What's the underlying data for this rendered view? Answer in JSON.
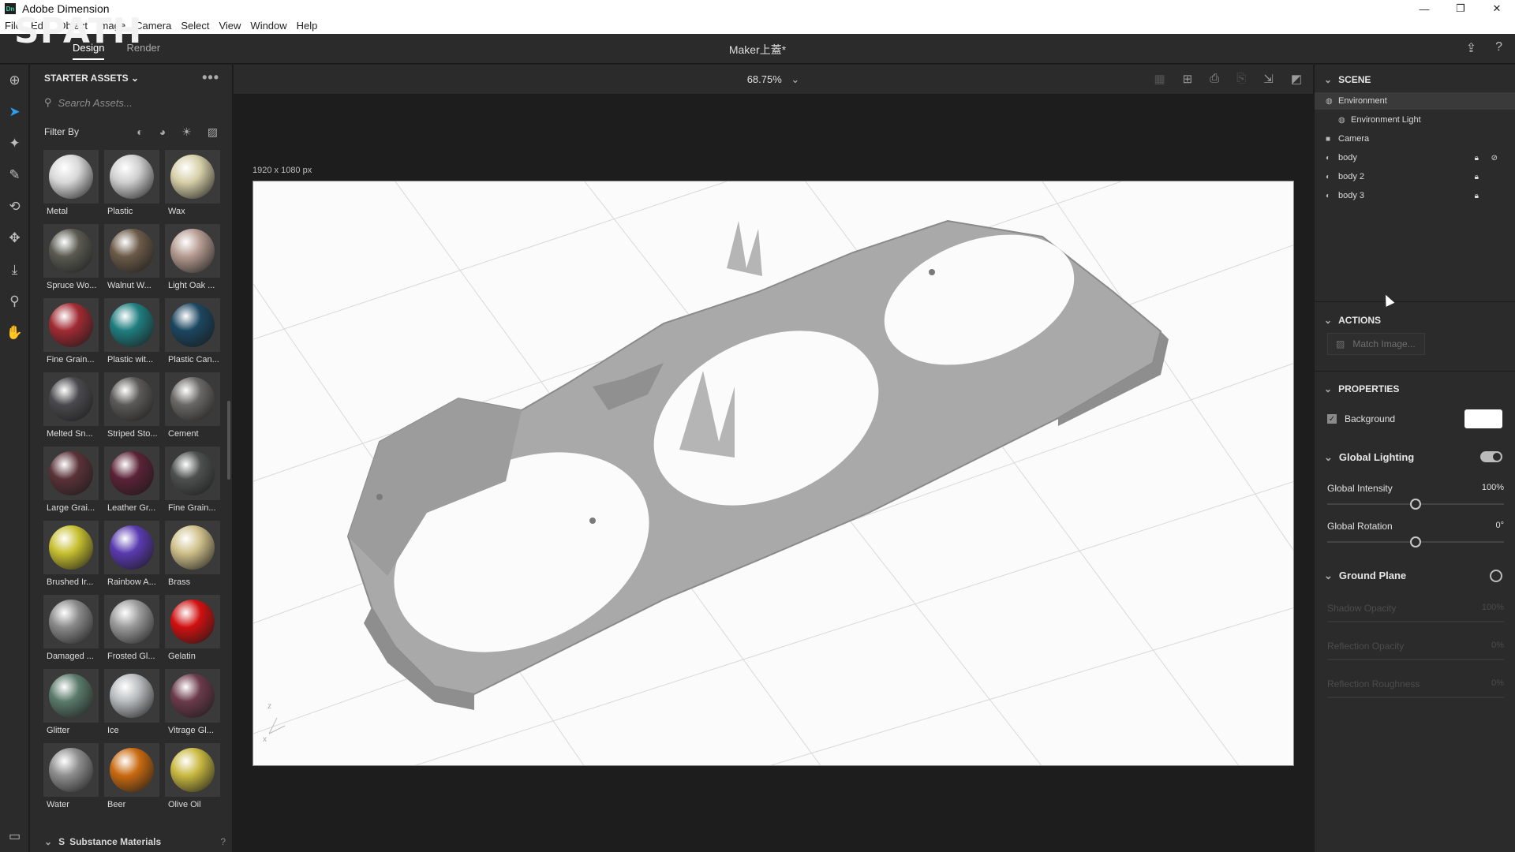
{
  "window": {
    "title": "Adobe Dimension",
    "logo_text": "Dn",
    "controls": [
      "—",
      "❐",
      "✕"
    ]
  },
  "menu": {
    "items": [
      "File",
      "Edit",
      "Object",
      "Image",
      "Camera",
      "Select",
      "View",
      "Window",
      "Help"
    ]
  },
  "topbar": {
    "brand_overlay": "SPATH",
    "tabs": [
      "Design",
      "Render"
    ],
    "document_title": "Maker上蓋*"
  },
  "assets": {
    "header": "STARTER ASSETS ⌄",
    "search_placeholder": "Search Assets...",
    "filter_label": "Filter By",
    "materials": [
      {
        "label": "Metal",
        "color": "#d8d8d8"
      },
      {
        "label": "Plastic",
        "color": "#cfcfcf"
      },
      {
        "label": "Wax",
        "color": "#d6cfa8"
      },
      {
        "label": "Spruce Wo...",
        "color": "#5a5a52"
      },
      {
        "label": "Walnut W...",
        "color": "#6b5a48"
      },
      {
        "label": "Light Oak ...",
        "color": "#b49a90"
      },
      {
        "label": "Fine Grain...",
        "color": "#a02a32"
      },
      {
        "label": "Plastic wit...",
        "color": "#1f7d7f"
      },
      {
        "label": "Plastic Can...",
        "color": "#1b4660"
      },
      {
        "label": "Melted Sn...",
        "color": "#4a4a4e"
      },
      {
        "label": "Striped Sto...",
        "color": "#5c5a58"
      },
      {
        "label": "Cement",
        "color": "#6a6866"
      },
      {
        "label": "Large Grai...",
        "color": "#5a3238"
      },
      {
        "label": "Leather Gr...",
        "color": "#5a2236"
      },
      {
        "label": "Fine Grain...",
        "color": "#4e5050"
      },
      {
        "label": "Brushed Ir...",
        "color": "#c8c030"
      },
      {
        "label": "Rainbow A...",
        "color": "#5a3ab0"
      },
      {
        "label": "Brass",
        "color": "#cfc08a"
      },
      {
        "label": "Damaged ...",
        "color": "#8a8a8a"
      },
      {
        "label": "Frosted Gl...",
        "color": "#9a9a9a"
      },
      {
        "label": "Gelatin",
        "color": "#d01010"
      },
      {
        "label": "Glitter",
        "color": "#5a7a6a"
      },
      {
        "label": "Ice",
        "color": "#b8bcbe"
      },
      {
        "label": "Vitrage Gl...",
        "color": "#6a3a4a"
      },
      {
        "label": "Water",
        "color": "#8e8e8e"
      },
      {
        "label": "Beer",
        "color": "#c86a10"
      },
      {
        "label": "Olive Oil",
        "color": "#c8b840"
      }
    ],
    "substance_label": "Substance Materials",
    "help": "?"
  },
  "canvas": {
    "zoom": "68.75%",
    "size_label": "1920 x 1080 px",
    "axis_labels": [
      "z",
      "x"
    ]
  },
  "scene": {
    "title": "SCENE",
    "items": [
      {
        "label": "Environment",
        "icon": "globe-icon",
        "highlight": true
      },
      {
        "label": "Environment Light",
        "icon": "globe-icon",
        "indent": true
      },
      {
        "label": "Camera",
        "icon": "camera-icon"
      },
      {
        "label": "body",
        "icon": "object-icon",
        "locked": true,
        "hidden": true
      },
      {
        "label": "body 2",
        "icon": "object-icon",
        "locked": true
      },
      {
        "label": "body 3",
        "icon": "object-icon",
        "locked": true
      }
    ]
  },
  "actions": {
    "title": "ACTIONS",
    "match_image": "Match Image..."
  },
  "properties": {
    "title": "PROPERTIES",
    "background_label": "Background",
    "background_color": "#ffffff",
    "global_lighting": "Global Lighting",
    "global_intensity_label": "Global Intensity",
    "global_intensity_value": "100%",
    "global_intensity_level": 0.5,
    "global_rotation_label": "Global Rotation",
    "global_rotation_value": "0°",
    "global_rotation_level": 0.5,
    "ground_plane": "Ground Plane",
    "shadow_opacity_label": "Shadow Opacity",
    "shadow_opacity_value": "100%",
    "reflection_opacity_label": "Reflection Opacity",
    "reflection_opacity_value": "0%",
    "reflection_roughness_label": "Reflection Roughness",
    "reflection_roughness_value": "0%"
  }
}
